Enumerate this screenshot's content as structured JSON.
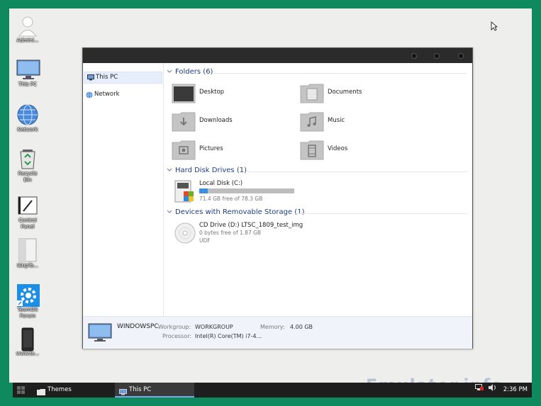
{
  "desktop": {
    "icons": [
      {
        "label": "Admini...",
        "icon": "user-icon"
      },
      {
        "label": "This PC",
        "icon": "monitor-icon"
      },
      {
        "label": "Network",
        "icon": "globe-icon"
      },
      {
        "label": "Recycle Bin",
        "icon": "recycle-bin-icon"
      },
      {
        "label": "Control Panel",
        "icon": "control-panel-icon"
      },
      {
        "label": "ISUpTo...",
        "icon": "file-icon"
      },
      {
        "label": "TeamOS Forum",
        "icon": "gear-icon"
      },
      {
        "label": "www.te...",
        "icon": "phone-icon"
      }
    ]
  },
  "window": {
    "nav": [
      {
        "label": "This PC",
        "icon": "monitor-icon",
        "selected": true
      },
      {
        "label": "Network",
        "icon": "network-icon",
        "selected": false
      }
    ],
    "groups": {
      "folders": "Folders (6)",
      "hdd": "Hard Disk Drives (1)",
      "removable": "Devices with Removable Storage (1)"
    },
    "folders": [
      "Desktop",
      "Documents",
      "Downloads",
      "Music",
      "Pictures",
      "Videos"
    ],
    "drives": {
      "local": {
        "name": "Local Disk (C:)",
        "free": "71.4 GB free of 78.3 GB",
        "used_fraction": 0.088
      },
      "cd": {
        "name": "CD Drive (D:) LTSC_1809_test_img",
        "free": "0 bytes free of 1.87 GB",
        "fs": "UDF"
      }
    },
    "details": {
      "pc_name": "WINDOWSPC",
      "workgroup_label": "Workgroup:",
      "workgroup": "WORKGROUP",
      "memory_label": "Memory:",
      "memory": "4.00 GB",
      "processor_label": "Processor:",
      "processor": "Intel(R) Core(TM) i7-4..."
    }
  },
  "taskbar": {
    "items": [
      {
        "label": "Themes",
        "icon": "folder-icon"
      },
      {
        "label": "This PC",
        "icon": "monitor-icon"
      }
    ],
    "clock": "2:36 PM"
  },
  "watermark": "Emulator.info",
  "colors": {
    "desktop_bg": "#0f8a5f",
    "accent": "#1e3c84",
    "progress": "#3b8fe0"
  }
}
